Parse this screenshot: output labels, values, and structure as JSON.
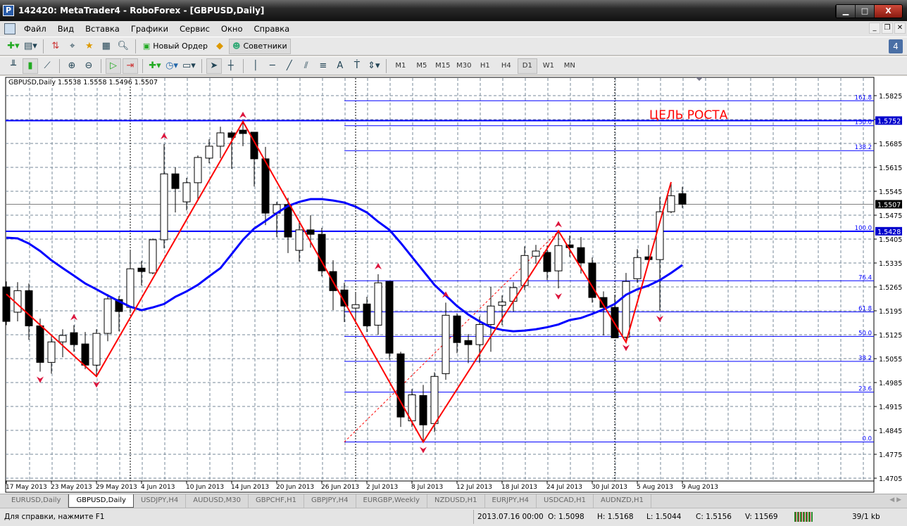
{
  "window": {
    "title": "142420: MetaTrader4 - RoboForex - [GBPUSD,Daily]",
    "min": "▁",
    "max": "□",
    "close": "X"
  },
  "menu": [
    "Файл",
    "Вид",
    "Вставка",
    "Графики",
    "Сервис",
    "Окно",
    "Справка"
  ],
  "toolbar1": {
    "new_order": "Новый Ордер",
    "experts": "Советники",
    "notifications": "4"
  },
  "toolbar2": {
    "timeframes": [
      "M1",
      "M5",
      "M15",
      "M30",
      "H1",
      "H4",
      "D1",
      "W1",
      "MN"
    ],
    "active_timeframe": "D1"
  },
  "chart": {
    "legend": "GBPUSD,Daily  1.5538 1.5558 1.5496 1.5507",
    "annotation": "ЦЕЛЬ РОСТА",
    "colors": {
      "line": "#0000ff",
      "zigzag": "#ff0000",
      "arrow": "#dc143c",
      "grid": "#778899",
      "bid_line": "#808080",
      "label_bg": "#0000cc"
    }
  },
  "chart_data": {
    "type": "candlestick",
    "symbol": "GBPUSD",
    "period": "Daily",
    "ylim": [
      1.4705,
      1.5825
    ],
    "y_ticks": [
      "1.5825",
      "1.5755",
      "1.5685",
      "1.5615",
      "1.5545",
      "1.5475",
      "1.5405",
      "1.5335",
      "1.5265",
      "1.5195",
      "1.5125",
      "1.5055",
      "1.4985",
      "1.4915",
      "1.4845",
      "1.4775",
      "1.4705"
    ],
    "x_ticks": [
      {
        "i": 0,
        "label": "17 May 2013"
      },
      {
        "i": 4,
        "label": "23 May 2013"
      },
      {
        "i": 8,
        "label": "29 May 2013"
      },
      {
        "i": 12,
        "label": "4 Jun 2013"
      },
      {
        "i": 16,
        "label": "10 Jun 2013"
      },
      {
        "i": 20,
        "label": "14 Jun 2013"
      },
      {
        "i": 24,
        "label": "20 Jun 2013"
      },
      {
        "i": 28,
        "label": "26 Jun 2013"
      },
      {
        "i": 32,
        "label": "2 Jul 2013"
      },
      {
        "i": 36,
        "label": "8 Jul 2013"
      },
      {
        "i": 40,
        "label": "12 Jul 2013"
      },
      {
        "i": 44,
        "label": "18 Jul 2013"
      },
      {
        "i": 48,
        "label": "24 Jul 2013"
      },
      {
        "i": 52,
        "label": "30 Jul 2013"
      },
      {
        "i": 56,
        "label": "5 Aug 2013"
      },
      {
        "i": 60,
        "label": "9 Aug 2013"
      }
    ],
    "ohlc": [
      [
        1.5265,
        1.5281,
        1.5153,
        1.5164
      ],
      [
        1.5191,
        1.5279,
        1.5164,
        1.5254
      ],
      [
        1.5254,
        1.5275,
        1.511,
        1.5151
      ],
      [
        1.5151,
        1.5172,
        1.5017,
        1.5044
      ],
      [
        1.5044,
        1.512,
        1.5011,
        1.5104
      ],
      [
        1.5104,
        1.5141,
        1.5059,
        1.5123
      ],
      [
        1.5131,
        1.5153,
        1.5075,
        1.5096
      ],
      [
        1.5098,
        1.5133,
        1.5024,
        1.5036
      ],
      [
        1.5036,
        1.5141,
        1.5003,
        1.5129
      ],
      [
        1.5129,
        1.5244,
        1.5106,
        1.523
      ],
      [
        1.5228,
        1.5238,
        1.5135,
        1.5193
      ],
      [
        1.5205,
        1.5374,
        1.5188,
        1.5318
      ],
      [
        1.532,
        1.5341,
        1.5269,
        1.531
      ],
      [
        1.5306,
        1.5407,
        1.5302,
        1.5403
      ],
      [
        1.5403,
        1.5683,
        1.5378,
        1.5596
      ],
      [
        1.5596,
        1.5615,
        1.5483,
        1.5553
      ],
      [
        1.5514,
        1.5584,
        1.5489,
        1.557
      ],
      [
        1.557,
        1.565,
        1.5522,
        1.5644
      ],
      [
        1.5642,
        1.5697,
        1.5627,
        1.5677
      ],
      [
        1.5677,
        1.5734,
        1.5642,
        1.5716
      ],
      [
        1.5716,
        1.5722,
        1.5611,
        1.5703
      ],
      [
        1.5724,
        1.5745,
        1.5677,
        1.5714
      ],
      [
        1.5718,
        1.5718,
        1.5559,
        1.564
      ],
      [
        1.564,
        1.5675,
        1.5446,
        1.5481
      ],
      [
        1.5481,
        1.5514,
        1.5411,
        1.5506
      ],
      [
        1.5506,
        1.5526,
        1.5364,
        1.5411
      ],
      [
        1.5372,
        1.5454,
        1.5339,
        1.5432
      ],
      [
        1.5432,
        1.5475,
        1.538,
        1.5419
      ],
      [
        1.5419,
        1.5438,
        1.5296,
        1.5312
      ],
      [
        1.531,
        1.5343,
        1.5197,
        1.5254
      ],
      [
        1.5256,
        1.5277,
        1.5162,
        1.5209
      ],
      [
        1.5203,
        1.525,
        1.5158,
        1.5213
      ],
      [
        1.5215,
        1.5236,
        1.5133,
        1.5151
      ],
      [
        1.5153,
        1.5302,
        1.5125,
        1.5277
      ],
      [
        1.5281,
        1.5281,
        1.5052,
        1.5071
      ],
      [
        1.5069,
        1.5075,
        1.4855,
        1.4884
      ],
      [
        1.4873,
        1.4966,
        1.4855,
        1.4949
      ],
      [
        1.4947,
        1.4978,
        1.4811,
        1.4861
      ],
      [
        1.4865,
        1.5015,
        1.484,
        1.5003
      ],
      [
        1.5011,
        1.5219,
        1.4993,
        1.5182
      ],
      [
        1.518,
        1.5188,
        1.5071,
        1.5102
      ],
      [
        1.5108,
        1.5127,
        1.5042,
        1.5096
      ],
      [
        1.5096,
        1.5178,
        1.5042,
        1.5155
      ],
      [
        1.5155,
        1.5265,
        1.5075,
        1.5209
      ],
      [
        1.5211,
        1.524,
        1.5153,
        1.5221
      ],
      [
        1.5223,
        1.5279,
        1.5193,
        1.5263
      ],
      [
        1.5269,
        1.5384,
        1.5256,
        1.5357
      ],
      [
        1.5355,
        1.5388,
        1.5333,
        1.537
      ],
      [
        1.5366,
        1.5386,
        1.5285,
        1.531
      ],
      [
        1.5312,
        1.5425,
        1.5261,
        1.5386
      ],
      [
        1.5388,
        1.5415,
        1.5353,
        1.538
      ],
      [
        1.538,
        1.5411,
        1.5304,
        1.5335
      ],
      [
        1.5335,
        1.5351,
        1.5219,
        1.5234
      ],
      [
        1.5234,
        1.5252,
        1.5123,
        1.5205
      ],
      [
        1.5205,
        1.524,
        1.5116,
        1.5116
      ],
      [
        1.5118,
        1.5306,
        1.511,
        1.5281
      ],
      [
        1.5289,
        1.5376,
        1.5277,
        1.5351
      ],
      [
        1.5353,
        1.5388,
        1.5333,
        1.5345
      ],
      [
        1.5345,
        1.5528,
        1.5195,
        1.5485
      ],
      [
        1.5485,
        1.557,
        1.5481,
        1.5532
      ],
      [
        1.5538,
        1.5558,
        1.5496,
        1.5507
      ]
    ],
    "moving_average": [
      1.5409,
      1.5407,
      1.5392,
      1.537,
      1.5343,
      1.532,
      1.5298,
      1.5275,
      1.5258,
      1.524,
      1.5223,
      1.5207,
      1.5197,
      1.5205,
      1.5215,
      1.5236,
      1.5252,
      1.5271,
      1.5296,
      1.532,
      1.5361,
      1.5403,
      1.5436,
      1.5458,
      1.5481,
      1.5502,
      1.5514,
      1.5522,
      1.5522,
      1.5518,
      1.5512,
      1.55,
      1.5483,
      1.5456,
      1.5432,
      1.5394,
      1.5353,
      1.5312,
      1.5271,
      1.524,
      1.5209,
      1.5184,
      1.5164,
      1.5147,
      1.5139,
      1.5135,
      1.5137,
      1.5141,
      1.5147,
      1.5155,
      1.5168,
      1.5174,
      1.5186,
      1.5199,
      1.5215,
      1.5242,
      1.5258,
      1.5269,
      1.5285,
      1.5306,
      1.5329
    ],
    "zigzag": [
      {
        "i": 0,
        "p": 1.5244
      },
      {
        "i": 8,
        "p": 1.5003
      },
      {
        "i": 21,
        "p": 1.5749
      },
      {
        "i": 37,
        "p": 1.4811
      },
      {
        "i": 49,
        "p": 1.5429
      },
      {
        "i": 55,
        "p": 1.5103
      },
      {
        "i": 59,
        "p": 1.5572
      }
    ],
    "fractals_up": [
      {
        "i": 6,
        "p": 1.5153
      },
      {
        "i": 14,
        "p": 1.5683
      },
      {
        "i": 21,
        "p": 1.5745
      },
      {
        "i": 33,
        "p": 1.5302
      },
      {
        "i": 39,
        "p": 1.5219
      },
      {
        "i": 49,
        "p": 1.5425
      }
    ],
    "fractals_down": [
      {
        "i": 3,
        "p": 1.5017
      },
      {
        "i": 8,
        "p": 1.5003
      },
      {
        "i": 37,
        "p": 1.4811
      },
      {
        "i": 49,
        "p": 1.5261
      },
      {
        "i": 55,
        "p": 1.511
      },
      {
        "i": 58,
        "p": 1.5195
      }
    ],
    "fibonacci": {
      "start_i": 30,
      "levels": [
        {
          "label": "0.0",
          "p": 1.4811
        },
        {
          "label": "23.6",
          "p": 1.4957
        },
        {
          "label": "38.2",
          "p": 1.5047
        },
        {
          "label": "50.0",
          "p": 1.512
        },
        {
          "label": "61.8",
          "p": 1.5192
        },
        {
          "label": "76.4",
          "p": 1.5283
        },
        {
          "label": "100.0",
          "p": 1.5428
        },
        {
          "label": "138.2",
          "p": 1.5664
        },
        {
          "label": "150.0",
          "p": 1.5737
        },
        {
          "label": "161.8",
          "p": 1.581
        }
      ]
    },
    "fib_trendline": [
      {
        "i": 30,
        "p": 1.4811
      },
      {
        "i": 49,
        "p": 1.5428
      }
    ],
    "hlines": [
      {
        "p": 1.5752,
        "label": "1.5752"
      },
      {
        "p": 1.5428,
        "label": "1.5428"
      }
    ],
    "bid": {
      "p": 1.5507,
      "label": "1.5507"
    },
    "period_separators": [
      11,
      31,
      54
    ]
  },
  "tabs": [
    {
      "label": "EURUSD,Daily"
    },
    {
      "label": "GBPUSD,Daily",
      "active": true
    },
    {
      "label": "USDJPY,H4"
    },
    {
      "label": "AUDUSD,M30"
    },
    {
      "label": "GBPCHF,H1"
    },
    {
      "label": "GBPJPY,H4"
    },
    {
      "label": "EURGBP,Weekly"
    },
    {
      "label": "NZDUSD,H1"
    },
    {
      "label": "EURJPY,H4"
    },
    {
      "label": "USDCAD,H1"
    },
    {
      "label": "AUDNZD,H1"
    }
  ],
  "status": {
    "help": "Для справки, нажмите F1",
    "datetime": "2013.07.16 00:00",
    "open": "O: 1.5098",
    "high": "H: 1.5168",
    "low": "L: 1.5044",
    "close": "C: 1.5156",
    "volume": "V: 11569",
    "traffic": "39/1 kb"
  }
}
